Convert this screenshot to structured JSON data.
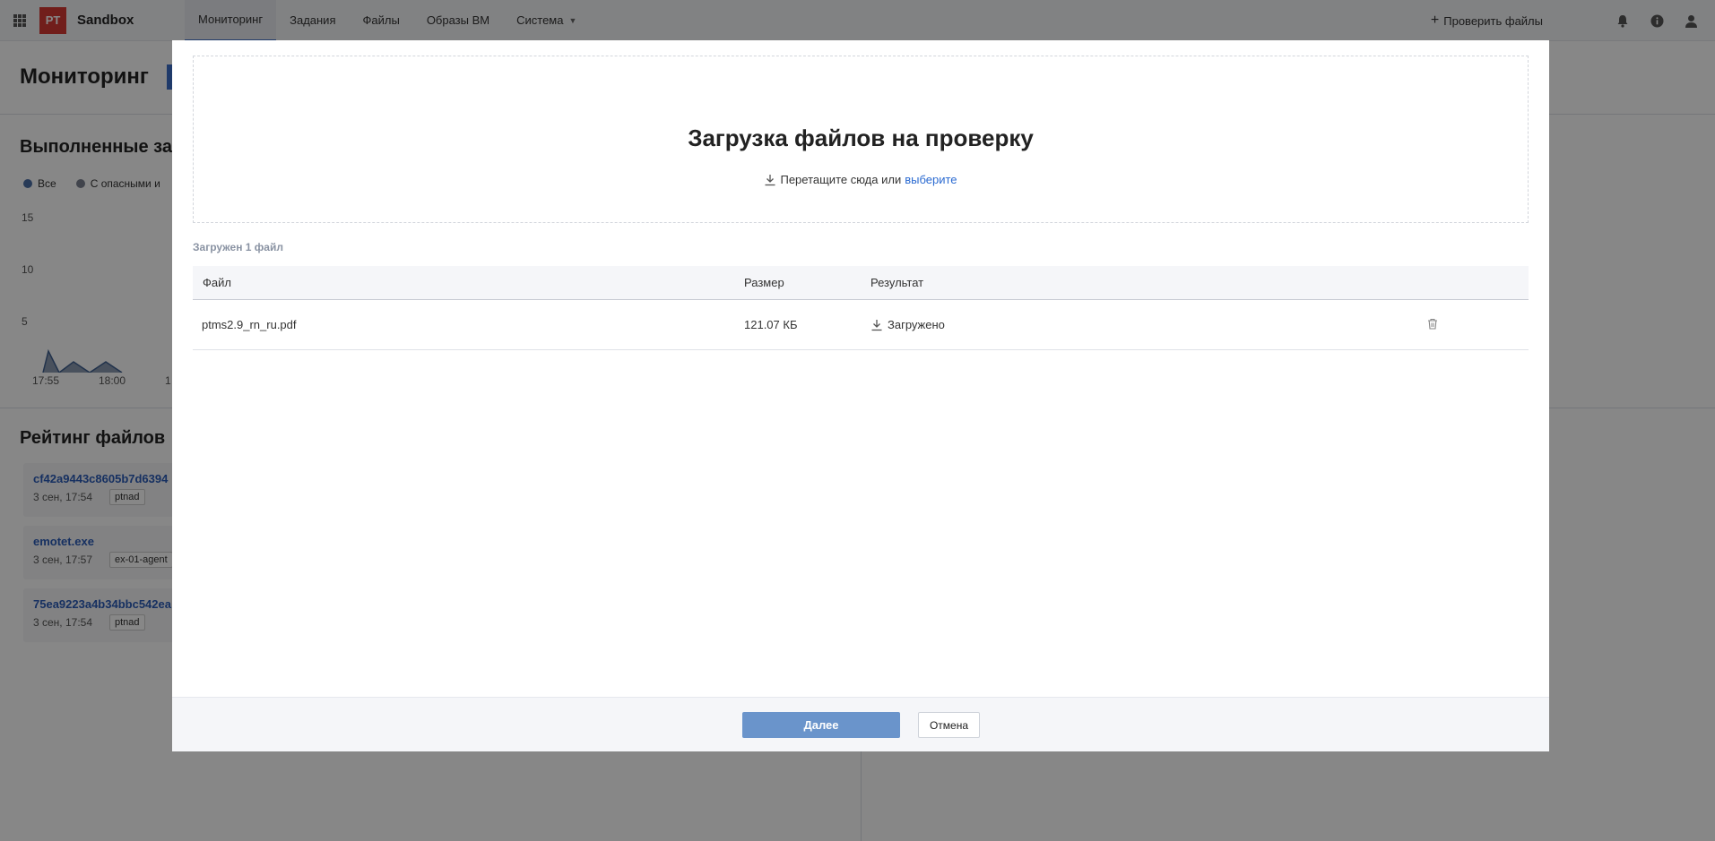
{
  "app": {
    "logo_text": "PT",
    "name": "Sandbox"
  },
  "nav": [
    {
      "label": "Мониторинг",
      "active": true
    },
    {
      "label": "Задания"
    },
    {
      "label": "Файлы"
    },
    {
      "label": "Образы ВМ"
    },
    {
      "label": "Система",
      "has_dropdown": true
    }
  ],
  "header_actions": {
    "check_files_label": "Проверить файлы",
    "icons": [
      "bell-icon",
      "info-icon",
      "user-icon"
    ]
  },
  "page": {
    "title": "Мониторинг",
    "completed_section_title": "Выполненные зад",
    "legend": [
      {
        "label": "Все",
        "color": "#4a6fa5"
      },
      {
        "label": "С опасными и",
        "color": "#7b8190"
      }
    ],
    "chart_yticks": [
      "15",
      "10",
      "5"
    ],
    "chart_xticks": [
      "17:55",
      "18:00",
      "1"
    ],
    "rating_section_title": "Рейтинг файлов",
    "rating": [
      {
        "name": "cf42a9443c8605b7d6394",
        "date": "3 сен, 17:54",
        "tag": "ptnad"
      },
      {
        "name": "emotet.exe",
        "date": "3 сен, 17:57",
        "tag": "ex-01-agent"
      },
      {
        "name": "75ea9223a4b34bbc542ea",
        "date": "3 сен, 17:54",
        "tag": "ptnad"
      }
    ]
  },
  "modal": {
    "title": "Загрузка файлов на проверку",
    "drop_hint": "Перетащите сюда или",
    "drop_link": "выберите",
    "loaded_count": "Загружен 1 файл",
    "columns": {
      "file": "Файл",
      "size": "Размер",
      "result": "Результат"
    },
    "files": [
      {
        "name": "ptms2.9_rn_ru.pdf",
        "size": "121.07 КБ",
        "result": "Загружено"
      }
    ],
    "next_label": "Далее",
    "cancel_label": "Отмена"
  },
  "colors": {
    "accent": "#2a6ad1",
    "brand_red": "#d63a33",
    "primary_button": "#6a94cb"
  }
}
